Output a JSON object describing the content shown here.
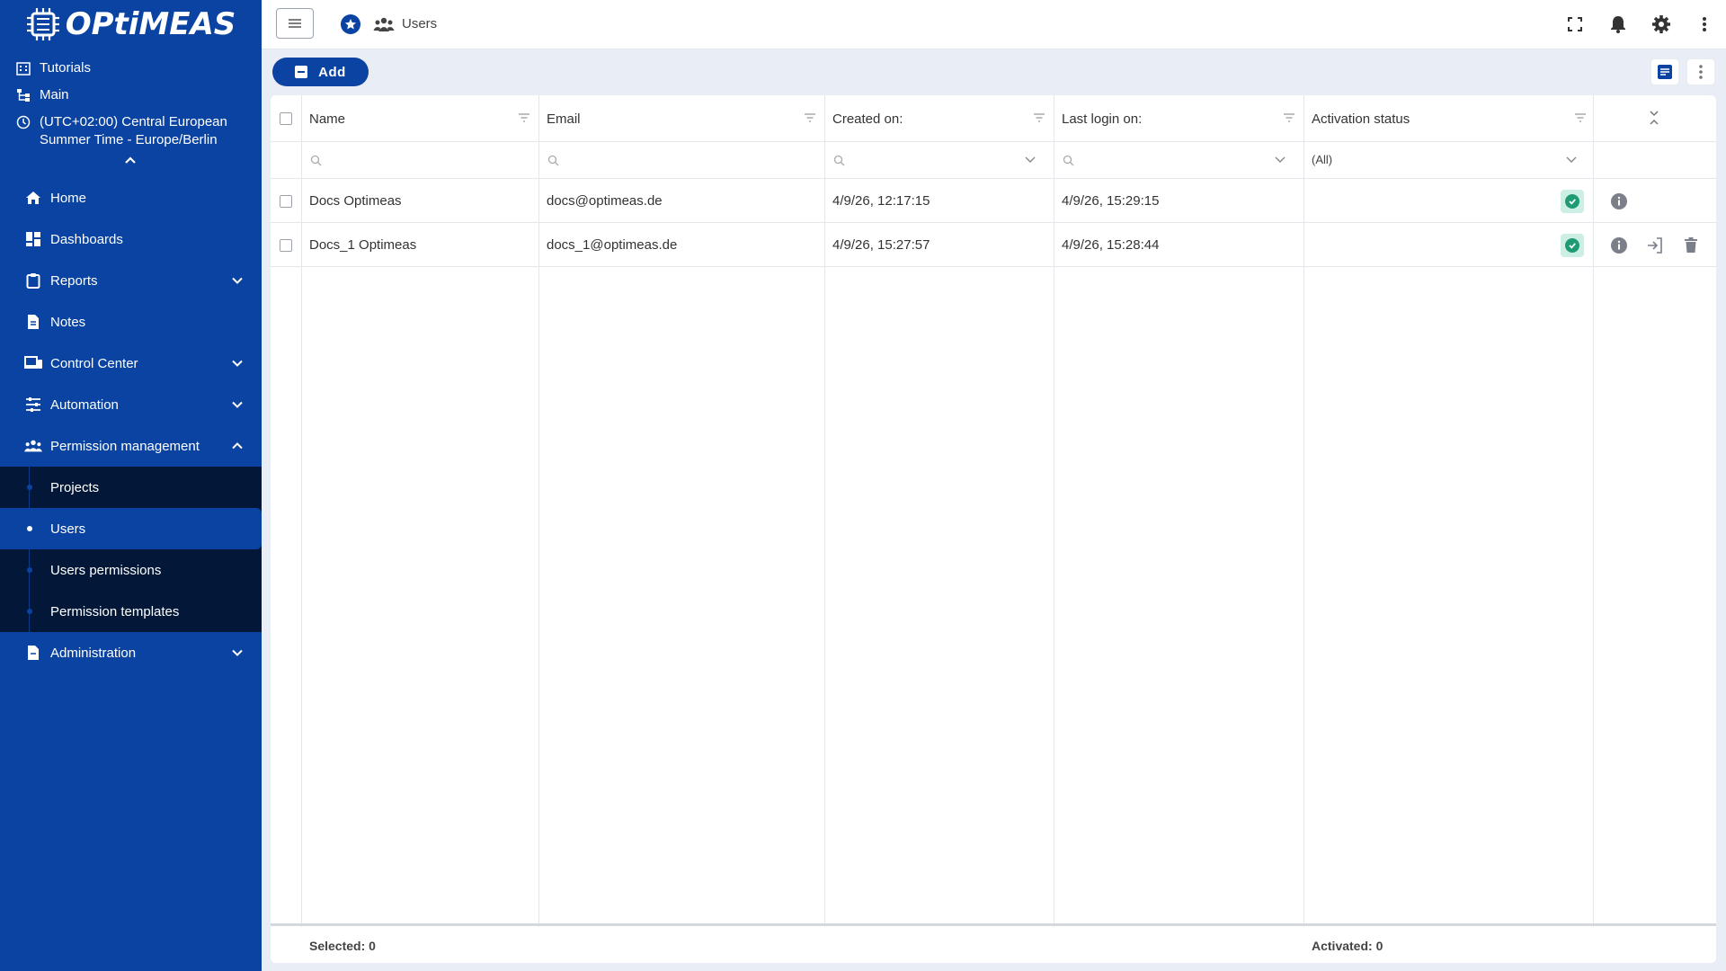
{
  "brand": {
    "name": "OPtiMEAS"
  },
  "sidebar": {
    "meta": {
      "tutorials": "Tutorials",
      "main": "Main",
      "timezone_line1": "(UTC+02:00) Central European",
      "timezone_line2": "Summer Time - Europe/Berlin"
    },
    "menu": [
      {
        "label": "Home",
        "icon": "home-icon"
      },
      {
        "label": "Dashboards",
        "icon": "dashboard-icon"
      },
      {
        "label": "Reports",
        "icon": "clipboard-icon"
      },
      {
        "label": "Notes",
        "icon": "note-icon"
      },
      {
        "label": "Control Center",
        "icon": "devices-icon"
      },
      {
        "label": "Automation",
        "icon": "sliders-icon"
      },
      {
        "label": "Permission management",
        "icon": "people-icon"
      }
    ],
    "submenu": [
      {
        "label": "Projects"
      },
      {
        "label": "Users"
      },
      {
        "label": "Users permissions"
      },
      {
        "label": "Permission templates"
      }
    ],
    "administration": {
      "label": "Administration",
      "icon": "admin-icon"
    }
  },
  "topbar": {
    "breadcrumb": "Users"
  },
  "toolbar": {
    "add_label": "Add"
  },
  "table": {
    "columns": [
      "Name",
      "Email",
      "Created on:",
      "Last login on:",
      "Activation status"
    ],
    "status_filter": "(All)",
    "rows": [
      {
        "name": "Docs Optimeas",
        "email": "docs@optimeas.de",
        "created": "4/9/26, 12:17:15",
        "last_login": "4/9/26, 15:29:15",
        "activated": true
      },
      {
        "name": "Docs_1 Optimeas",
        "email": "docs_1@optimeas.de",
        "created": "4/9/26, 15:27:57",
        "last_login": "4/9/26, 15:28:44",
        "activated": true
      }
    ],
    "footer": {
      "selected": "Selected: 0",
      "activated": "Activated: 0"
    }
  },
  "colors": {
    "brand": "#0a43a2",
    "sidebar_dark": "#031838",
    "success": "#1f9b73"
  }
}
